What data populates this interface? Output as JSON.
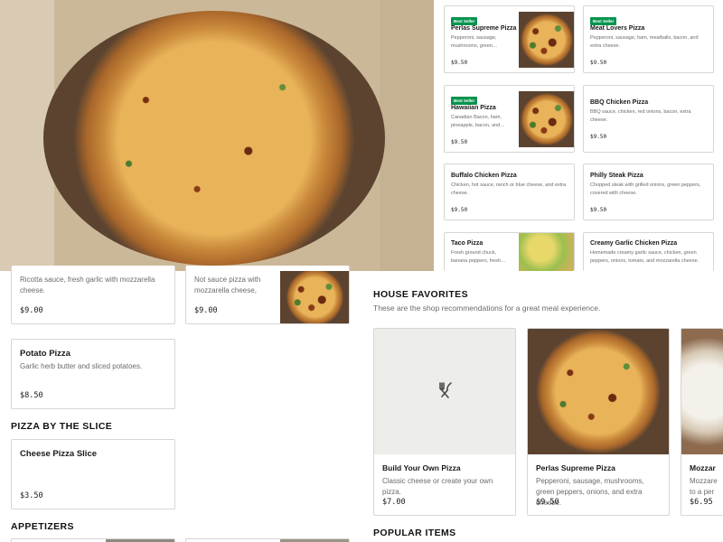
{
  "hero": {
    "image_icon": "pizza-photo"
  },
  "top_grid": [
    {
      "badge": "Best Seller",
      "name": "Perlas Supreme Pizza",
      "desc": "Pepperoni, sausage, mushrooms, green…",
      "price": "$9.50"
    },
    {
      "badge": "Best Seller",
      "name": "Meat Lovers Pizza",
      "desc": "Pepperoni, sausage, ham, meatballs, bacon, and extra cheese.",
      "price": "$9.50"
    },
    {
      "badge": "Best Seller",
      "name": "Hawaiian Pizza",
      "desc": "Canadian Bacon, ham, pineapple, bacon, and…",
      "price": "$9.50"
    },
    {
      "name": "BBQ Chicken Pizza",
      "desc": "BBQ sauce, chicken, red onions, bacon, extra cheese.",
      "price": "$9.50"
    },
    {
      "name": "Buffalo Chicken Pizza",
      "desc": "Chicken, hot sauce, ranch or blue cheese, and extra cheese.",
      "price": "$9.50"
    },
    {
      "name": "Philly Steak Pizza",
      "desc": "Chopped steak with grilled onions, green peppers, covered with cheese.",
      "price": "$9.50"
    },
    {
      "name": "Taco Pizza",
      "desc": "Fresh ground chuck, banana peppers, fresh…"
    },
    {
      "name": "Creamy Garlic Chicken Pizza",
      "desc": "Homemade creamy garlic sauce, chicken, green peppers, onions, tomato, and mozzarella cheese."
    }
  ],
  "left_cards": [
    {
      "desc": "Ricotta sauce, fresh garlic with mozzarella cheese.",
      "price": "$9.00"
    },
    {
      "desc": "Not sauce pizza with mozzarella cheese, fresh…",
      "price": "$9.00"
    },
    {
      "name": "Potato Pizza",
      "desc": "Garlic herb butter and sliced potatoes.",
      "price": "$8.50"
    }
  ],
  "slice_section": {
    "title": "PIZZA BY THE SLICE",
    "item": {
      "name": "Cheese Pizza Slice",
      "price": "$3.50"
    }
  },
  "appetizers": {
    "title": "APPETIZERS"
  },
  "house_favorites": {
    "title": "HOUSE FAVORITES",
    "subtitle": "These are the shop recommendations for a great meal experience.",
    "items": [
      {
        "name": "Build Your Own Pizza",
        "desc": "Classic cheese or create your own pizza.",
        "price": "$7.00"
      },
      {
        "name": "Perlas Supreme Pizza",
        "desc": "Pepperoni, sausage, mushrooms, green peppers, onions, and extra cheese.",
        "price": "$9.50"
      },
      {
        "name": "Mozzar",
        "desc": "Mozzare to a per",
        "price": "$6.95"
      }
    ]
  },
  "popular": {
    "title": "POPULAR ITEMS"
  },
  "colors": {
    "badge": "#05944f",
    "border": "#d6d6d6",
    "muted": "#6b6b6b",
    "placeholder": "#ededea"
  }
}
